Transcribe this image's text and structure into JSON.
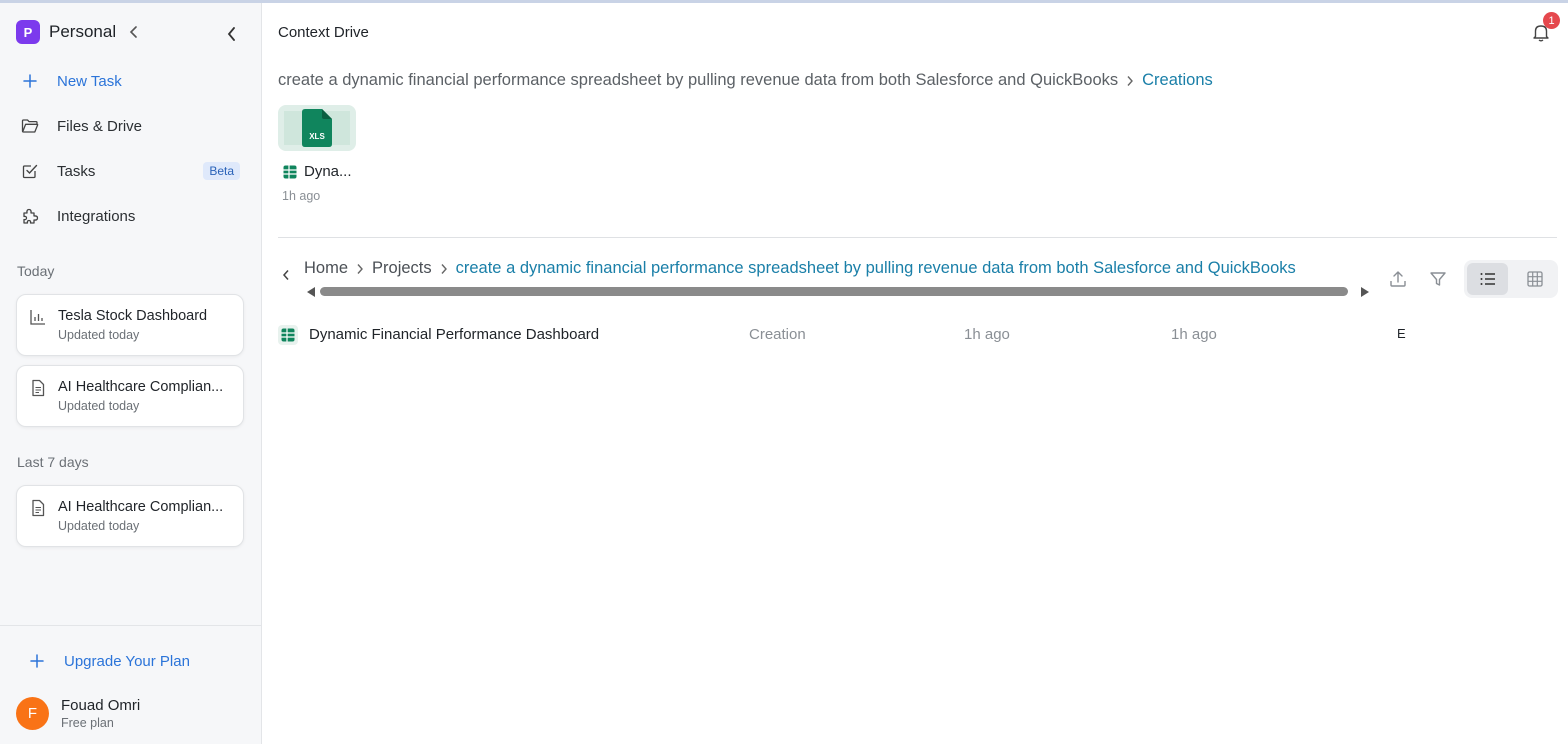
{
  "workspace": {
    "badge": "P",
    "name": "Personal"
  },
  "nav": {
    "new_task": "New Task",
    "files_drive": "Files & Drive",
    "tasks": "Tasks",
    "tasks_badge": "Beta",
    "integrations": "Integrations"
  },
  "sections": {
    "today": "Today",
    "last7": "Last 7 days"
  },
  "today_items": [
    {
      "title": "Tesla Stock Dashboard",
      "sub": "Updated today",
      "icon": "bar-chart-icon"
    },
    {
      "title": "AI Healthcare Complian...",
      "sub": "Updated today",
      "icon": "document-icon"
    }
  ],
  "last7_items": [
    {
      "title": "AI Healthcare Complian...",
      "sub": "Updated today",
      "icon": "document-icon"
    }
  ],
  "upgrade": "Upgrade Your Plan",
  "user": {
    "initial": "F",
    "name": "Fouad Omri",
    "plan": "Free plan"
  },
  "header": {
    "title": "Context Drive",
    "notification_count": "1"
  },
  "top_breadcrumb": {
    "parent": "create a dynamic financial performance spreadsheet by pulling revenue data from both Salesforce and QuickBooks",
    "current": "Creations"
  },
  "thumbnail": {
    "file_label": "XLS",
    "name": "Dyna...",
    "time": "1h ago"
  },
  "breadcrumb": {
    "home": "Home",
    "projects": "Projects",
    "current": "create a dynamic financial performance spreadsheet by pulling revenue data from both Salesforce and QuickBooks"
  },
  "files": [
    {
      "name": "Dynamic Financial Performance Dashboard",
      "type": "Creation",
      "created": "1h ago",
      "modified": "1h ago",
      "extra": "E"
    }
  ],
  "colors": {
    "accent": "#2b74d9",
    "workspace": "#7c3aed",
    "avatar": "#f97316",
    "link": "#1a7fa8",
    "sheet": "#10855d"
  }
}
